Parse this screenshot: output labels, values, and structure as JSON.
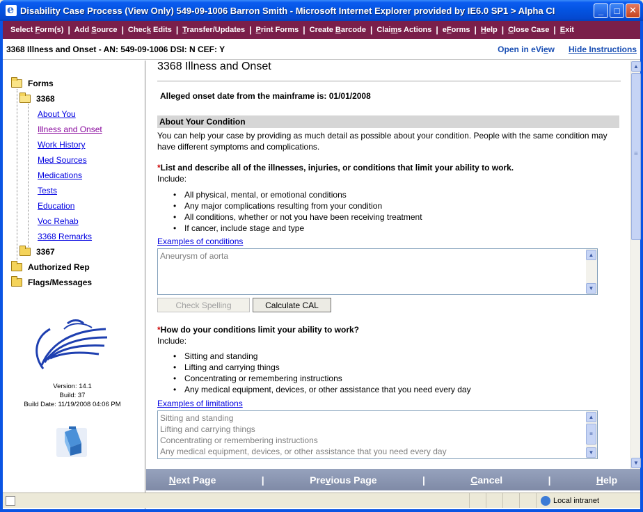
{
  "window": {
    "title": "Disability Case Process (View Only) 549-09-1006 Barron Smith - Microsoft Internet Explorer provided by IE6.0 SP1 > Alpha CI",
    "min_glyph": "_",
    "max_glyph": "□",
    "close_glyph": "✕"
  },
  "menu": [
    {
      "pre": "Select ",
      "key": "F",
      "post": "orm(s)"
    },
    {
      "pre": "Add ",
      "key": "S",
      "post": "ource"
    },
    {
      "pre": "Chec",
      "key": "k",
      "post": " Edits"
    },
    {
      "pre": "",
      "key": "T",
      "post": "ransfer/Updates"
    },
    {
      "pre": "",
      "key": "P",
      "post": "rint Forms"
    },
    {
      "pre": "Create ",
      "key": "B",
      "post": "arcode"
    },
    {
      "pre": "Clai",
      "key": "m",
      "post": "s Actions"
    },
    {
      "pre": "e",
      "key": "F",
      "post": "orms"
    },
    {
      "pre": "",
      "key": "H",
      "post": "elp"
    },
    {
      "pre": "",
      "key": "C",
      "post": "lose Case"
    },
    {
      "pre": "",
      "key": "E",
      "post": "xit"
    }
  ],
  "header": {
    "case_info": "3368 Illness and Onset - AN: 549-09-1006 DSI: N   CEF: Y",
    "open_eview_pre": "Open in eVi",
    "open_eview_key": "e",
    "open_eview_post": "w",
    "hide_instructions": "Hide Instructions"
  },
  "tree": {
    "forms": "Forms",
    "form_3368": "3368",
    "items": [
      "About You",
      "Illness and Onset",
      "Work History",
      "Med Sources",
      "Medications",
      "Tests",
      "Education",
      "Voc Rehab",
      "3368 Remarks"
    ],
    "form_3367": "3367",
    "authorized_rep": "Authorized Rep",
    "flags": "Flags/Messages"
  },
  "version": {
    "version": "Version: 14.1",
    "build": "Build: 37",
    "build_date": "Build Date: 11/19/2008 04:06 PM"
  },
  "content": {
    "page_title": "3368 Illness and Onset",
    "onset_text": "Alleged onset date from the mainframe is:  01/01/2008",
    "section_head": "About Your Condition",
    "help_text": "You can help your case by providing as much detail as possible about your condition. People with the same condition may have different symptoms and complications.",
    "req_mark": "*",
    "q1": "List and describe all of the illnesses, injuries, or conditions that limit your ability to work.",
    "include": "Include:",
    "q1_bullets": [
      "All physical, mental, or emotional conditions",
      "Any major complications resulting from your condition",
      "All conditions, whether or not you have been receiving treatment",
      "If cancer, include stage and type"
    ],
    "q1_examples": "Examples of conditions",
    "q1_value": "Aneurysm of aorta",
    "check_spelling": "Check Spelling",
    "calculate_cal": "Calculate CAL",
    "q2": "How do your conditions limit your ability to work?",
    "q2_bullets": [
      "Sitting and standing",
      "Lifting and carrying things",
      "Concentrating or remembering instructions",
      "Any medical equipment, devices, or other assistance that you need every day"
    ],
    "q2_examples": "Examples of limitations",
    "q2_value_lines": [
      "Sitting and standing",
      "Lifting and carrying things",
      "Concentrating or remembering instructions",
      "Any medical equipment, devices, or other assistance that you need every day"
    ]
  },
  "bottom": {
    "next": {
      "key": "N",
      "rest": "ext Page"
    },
    "previous": {
      "pre": "Pre",
      "key": "v",
      "post": "ious Page"
    },
    "cancel": {
      "key": "C",
      "rest": "ancel"
    },
    "help": {
      "key": "H",
      "rest": "elp"
    },
    "sep": "|"
  },
  "status": {
    "zone": "Local intranet"
  }
}
